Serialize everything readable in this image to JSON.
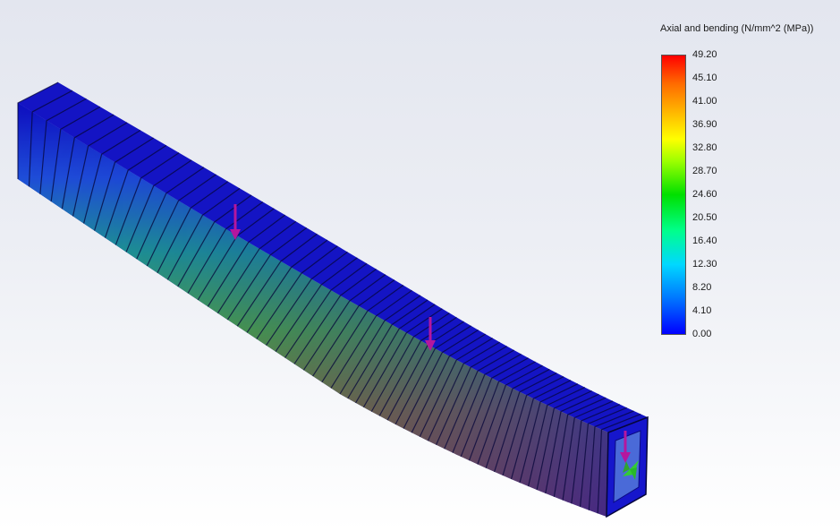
{
  "legend": {
    "title": "Axial and bending (N/mm^2 (MPa))",
    "ticks": [
      "49.20",
      "45.10",
      "41.00",
      "36.90",
      "32.80",
      "28.70",
      "24.60",
      "20.50",
      "16.40",
      "12.30",
      "8.20",
      "4.10",
      "0.00"
    ],
    "colors": {
      "max": "#ff0000",
      "min": "#0000ff"
    }
  },
  "model": {
    "beam_color": "#1212c8",
    "load_arrow_color": "#b5179e",
    "fixture_color": "#33cc33",
    "load_arrow_icon": "down-arrow-icon",
    "fixture_icon": "fixed-support-icon"
  }
}
